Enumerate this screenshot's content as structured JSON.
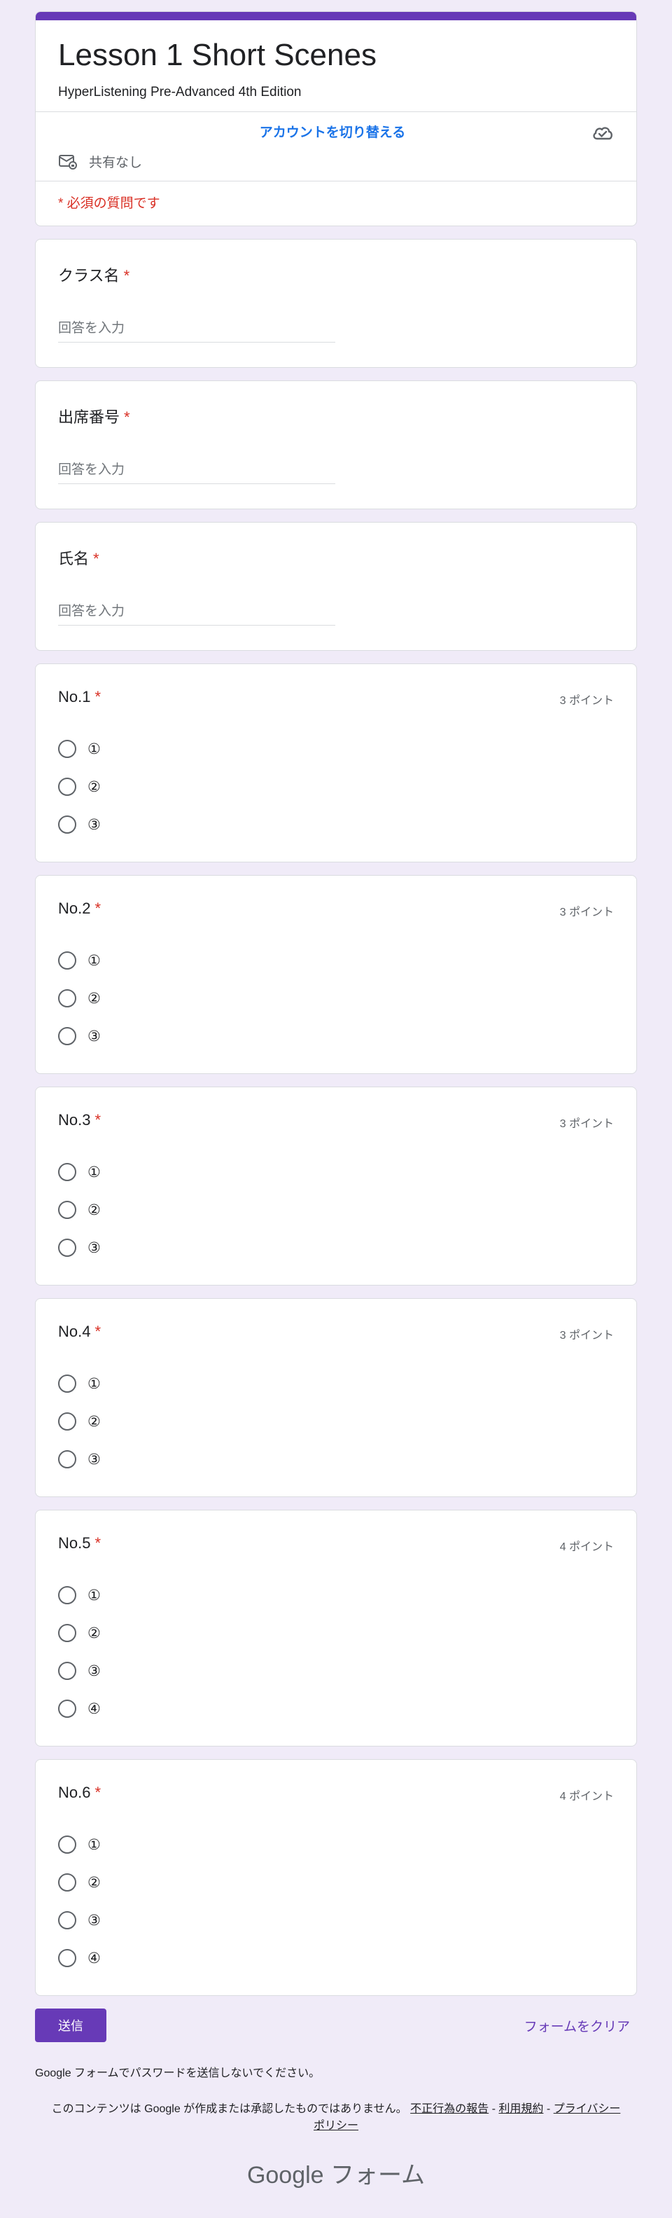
{
  "header": {
    "title": "Lesson 1 Short Scenes",
    "description": "HyperListening Pre-Advanced 4th Edition",
    "switch_account": "アカウントを切り替える",
    "shared": "共有なし",
    "required_note": "* 必須の質問です"
  },
  "text_questions": [
    {
      "label": "クラス名",
      "placeholder": "回答を入力"
    },
    {
      "label": "出席番号",
      "placeholder": "回答を入力"
    },
    {
      "label": "氏名",
      "placeholder": "回答を入力"
    }
  ],
  "required_star": "*",
  "choice_questions": [
    {
      "label": "No.1",
      "points": "3 ポイント",
      "options": [
        "①",
        "②",
        "③"
      ]
    },
    {
      "label": "No.2",
      "points": "3 ポイント",
      "options": [
        "①",
        "②",
        "③"
      ]
    },
    {
      "label": "No.3",
      "points": "3 ポイント",
      "options": [
        "①",
        "②",
        "③"
      ]
    },
    {
      "label": "No.4",
      "points": "3 ポイント",
      "options": [
        "①",
        "②",
        "③"
      ]
    },
    {
      "label": "No.5",
      "points": "4 ポイント",
      "options": [
        "①",
        "②",
        "③",
        "④"
      ]
    },
    {
      "label": "No.6",
      "points": "4 ポイント",
      "options": [
        "①",
        "②",
        "③",
        "④"
      ]
    }
  ],
  "footer": {
    "submit": "送信",
    "clear": "フォームをクリア",
    "password_note": "Google フォームでパスワードを送信しないでください。",
    "disclaimer_text": "このコンテンツは Google が作成または承認したものではありません。",
    "report_link": "不正行為の報告",
    "terms_link": "利用規約",
    "privacy_link": "プライバシーポリシー",
    "separator": "-",
    "brand_google": "Google",
    "brand_forms": "フォーム"
  },
  "colors": {
    "accent": "#673ab7",
    "required": "#d93025",
    "link": "#1a73e8",
    "background": "#f0ebf8"
  }
}
